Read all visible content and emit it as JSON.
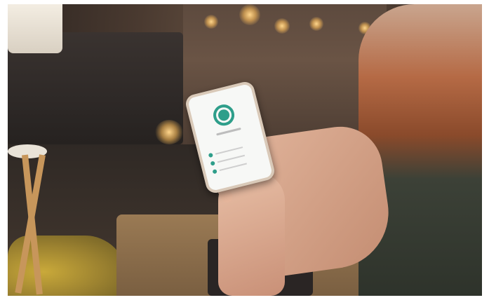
{
  "scene": {
    "description_tags": [
      "person",
      "smartphone",
      "living-room",
      "bokeh-lights",
      "coffee-table",
      "laptop"
    ],
    "accent_color": "#2e9e8a"
  },
  "phone_screen": {
    "icon": "shield-lock-icon",
    "list_rows": 3
  }
}
